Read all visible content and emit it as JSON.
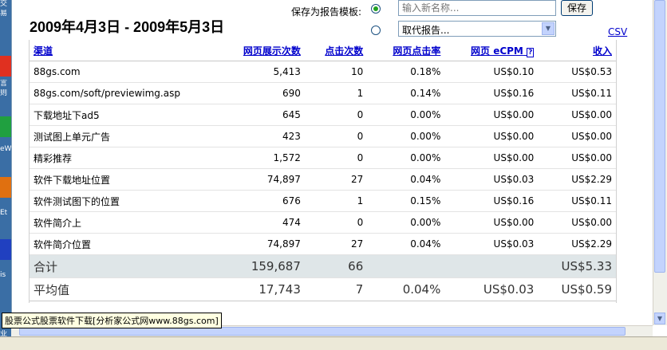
{
  "desktop": {
    "labels": [
      "交",
      "易",
      "言",
      "则",
      "eW",
      "Et",
      "is",
      "业"
    ],
    "colors": [
      "#e03020",
      "#20a040",
      "#e07010",
      "#2040c0"
    ]
  },
  "header": {
    "date_range": "2009年4月3日  - 2009年5月3日",
    "save_label": "保存为报告模板:",
    "name_input_placeholder": "输入新名称...",
    "save_button": "保存",
    "replace_select": "取代报告...",
    "csv_link": "CSV"
  },
  "table": {
    "columns": [
      "渠道",
      "网页展示次数",
      "点击次数",
      "网页点击率",
      "网页 eCPM",
      "收入"
    ],
    "help_mark": "?",
    "rows": [
      [
        "88gs.com",
        "5,413",
        "10",
        "0.18%",
        "US$0.10",
        "US$0.53"
      ],
      [
        "88gs.com/soft/previewimg.asp",
        "690",
        "1",
        "0.14%",
        "US$0.16",
        "US$0.11"
      ],
      [
        "下载地址下ad5",
        "645",
        "0",
        "0.00%",
        "US$0.00",
        "US$0.00"
      ],
      [
        "测试图上单元广告",
        "423",
        "0",
        "0.00%",
        "US$0.00",
        "US$0.00"
      ],
      [
        "精彩推荐",
        "1,572",
        "0",
        "0.00%",
        "US$0.00",
        "US$0.00"
      ],
      [
        "软件下载地址位置",
        "74,897",
        "27",
        "0.04%",
        "US$0.03",
        "US$2.29"
      ],
      [
        "软件测试图下的位置",
        "676",
        "1",
        "0.15%",
        "US$0.16",
        "US$0.11"
      ],
      [
        "软件简介上",
        "474",
        "0",
        "0.00%",
        "US$0.00",
        "US$0.00"
      ],
      [
        "软件简介位置",
        "74,897",
        "27",
        "0.04%",
        "US$0.03",
        "US$2.29"
      ]
    ],
    "total": [
      "合计",
      "159,687",
      "66",
      "",
      "",
      "US$5.33"
    ],
    "average": [
      "平均值",
      "17,743",
      "7",
      "0.04%",
      "US$0.03",
      "US$0.59"
    ]
  },
  "tooltip": "股票公式股票软件下载[分析家公式网www.88gs.com]"
}
